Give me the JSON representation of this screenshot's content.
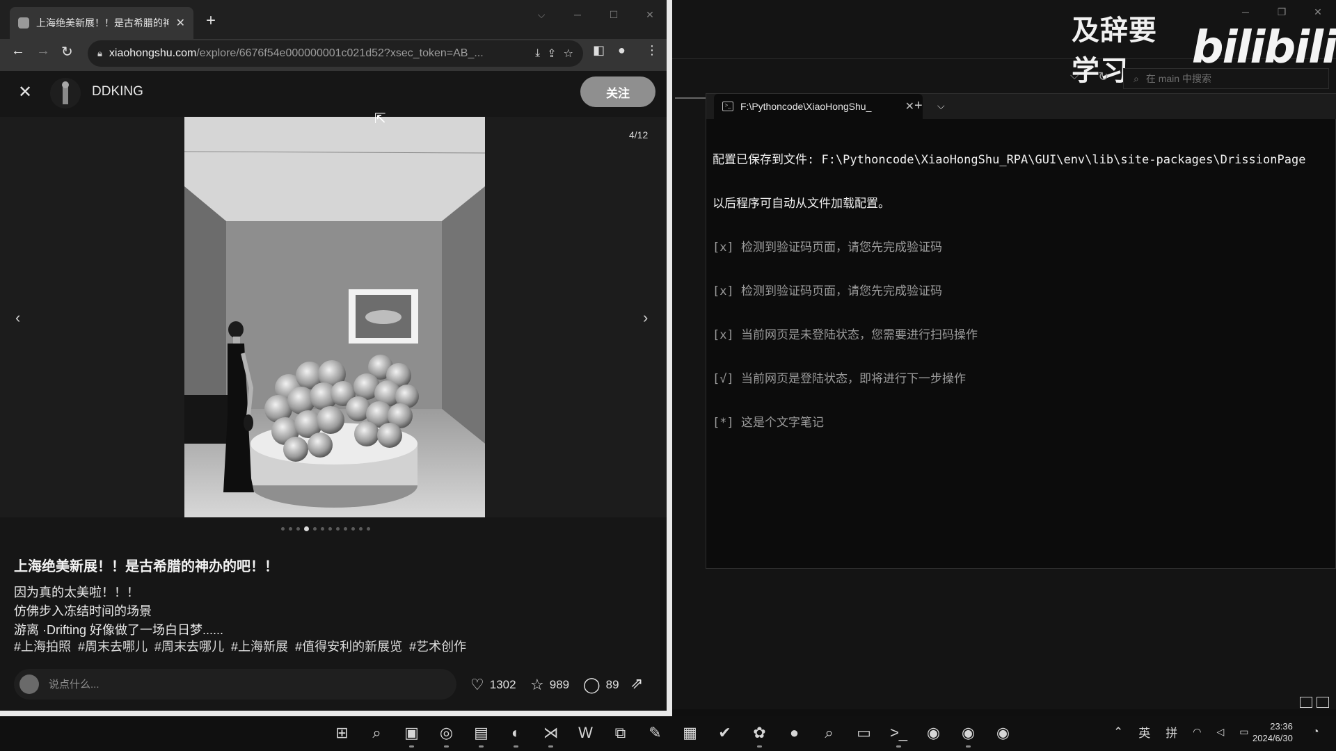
{
  "ide": {
    "watermark_text": "及辞要学习",
    "watermark_logo": "bilibili",
    "search_placeholder": "在 main 中搜索",
    "terminal": {
      "tab_title": "F:\\Pythoncode\\XiaoHongShu_",
      "lines": [
        "配置已保存到文件: F:\\Pythoncode\\XiaoHongShu_RPA\\GUI\\env\\lib\\site-packages\\DrissionPage",
        "以后程序可自动从文件加载配置。",
        "[x] 检测到验证码页面，请您先完成验证码",
        "[x] 检测到验证码页面，请您先完成验证码",
        "[x] 当前网页是未登陆状态，您需要进行扫码操作",
        "[√] 当前网页是登陆状态，即将进行下一步操作",
        "[*] 这是个文字笔记"
      ]
    }
  },
  "browser": {
    "tab_title": "上海绝美新展！！是古希腊的神办",
    "url_host": "xiaohongshu.com",
    "url_path": "/explore/6676f54e000000001c021d52?xsec_token=AB_..."
  },
  "note": {
    "author": "DDKING",
    "follow_label": "关注",
    "counter": "4/12",
    "total_images": 12,
    "current_image": 4,
    "title": "上海绝美新展！！是古希腊的神办的吧！！",
    "desc_lines": [
      "因为真的太美啦！！！",
      "仿佛步入冻结时间的场景",
      "游离 ·Drifting 好像做了一场白日梦......"
    ],
    "tags": [
      "#上海拍照",
      "#周末去哪儿",
      "#周末去哪儿",
      "#上海新展",
      "#值得安利的新展览",
      "#艺术创作"
    ],
    "comment_placeholder": "说点什么...",
    "likes": "1302",
    "collects": "989",
    "comments": "89"
  },
  "taskbar": {
    "ime_lang": "英",
    "ime_mode": "拼",
    "time": "23:36",
    "date": "2024/6/30"
  }
}
